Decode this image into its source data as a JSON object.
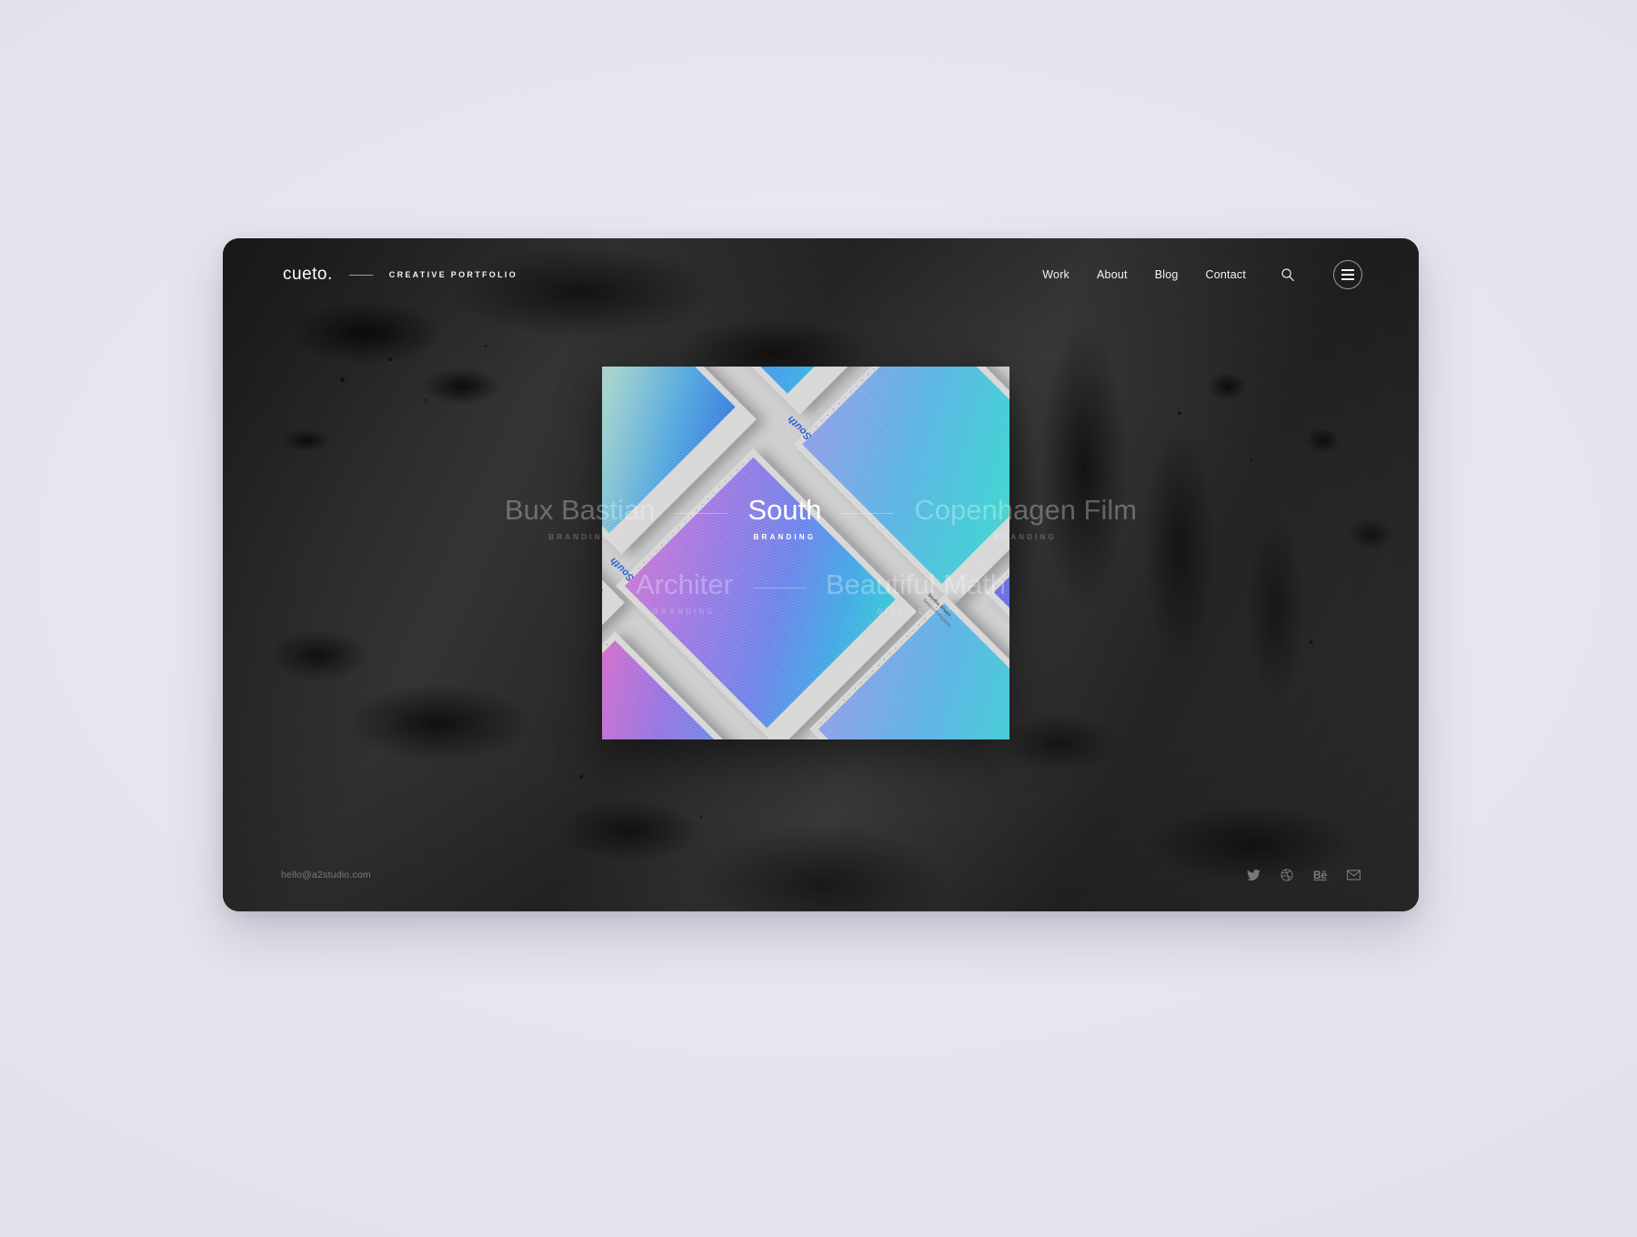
{
  "header": {
    "logo": "cueto.",
    "tagline": "CREATIVE PORTFOLIO",
    "nav": [
      {
        "label": "Work"
      },
      {
        "label": "About"
      },
      {
        "label": "Blog"
      },
      {
        "label": "Contact"
      }
    ],
    "search_icon": "search-icon",
    "menu_icon": "hamburger-menu-icon"
  },
  "hero": {
    "artwork_alt": "Studio South gradient poster collage",
    "artwork_cards": [
      {
        "title": "Studio South",
        "subtitle": "Selected Projects",
        "mark": "South"
      },
      {
        "title": "Studio South",
        "subtitle": "Selected Projects",
        "mark": "South"
      },
      {
        "title": "Studio South",
        "subtitle": "Selected Projects",
        "mark": "South"
      },
      {
        "title": "Studio South",
        "subtitle": "Selected Projects",
        "mark": "South"
      }
    ],
    "rows": [
      {
        "items": [
          {
            "title": "Bux Bastian",
            "category": "BRANDING",
            "active": false
          },
          {
            "title": "South",
            "category": "BRANDING",
            "active": true
          },
          {
            "title": "Copenhagen Film",
            "category": "BRANDING",
            "active": false
          }
        ]
      },
      {
        "items": [
          {
            "title": "Architer",
            "category": "BRANDING",
            "active": false
          },
          {
            "title": "Beautiful Math",
            "category": "DIGITAL ART",
            "active": false
          }
        ]
      }
    ]
  },
  "footer": {
    "email": "hello@a2studio.com",
    "social": [
      {
        "name": "twitter-icon",
        "label": "Twitter"
      },
      {
        "name": "dribbble-icon",
        "label": "Dribbble"
      },
      {
        "name": "behance-icon",
        "label": "Behance"
      },
      {
        "name": "email-icon",
        "label": "Email"
      }
    ]
  },
  "colors": {
    "page_background": "#e9e8f0",
    "window_background": "#303030",
    "text_primary": "#ffffff",
    "text_muted": "rgba(255,255,255,0.30)",
    "accent_blue": "#2f5fd0"
  }
}
